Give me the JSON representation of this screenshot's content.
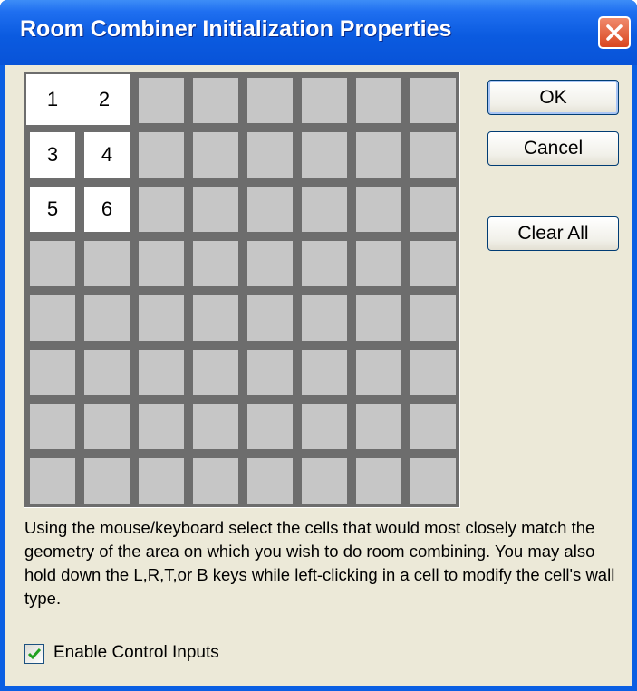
{
  "window": {
    "title": "Room Combiner Initialization Properties",
    "close_icon": "close-icon",
    "colors": {
      "titlebar": "#0a5fe3",
      "client": "#ece9d8",
      "close": "#d9461f"
    }
  },
  "grid": {
    "rows": 8,
    "columns": 8,
    "selected_cells": [
      {
        "row": 0,
        "col": 0,
        "label": "1"
      },
      {
        "row": 0,
        "col": 1,
        "label": "2"
      },
      {
        "row": 1,
        "col": 0,
        "label": "3"
      },
      {
        "row": 1,
        "col": 1,
        "label": "4"
      },
      {
        "row": 2,
        "col": 0,
        "label": "5"
      },
      {
        "row": 2,
        "col": 1,
        "label": "6"
      }
    ],
    "colors": {
      "wall": "#6d6d6d",
      "unselected": "#c6c6c6",
      "selected": "#ffffff"
    }
  },
  "buttons": {
    "ok": "OK",
    "cancel": "Cancel",
    "clear_all": "Clear All"
  },
  "instructions": "Using the mouse/keyboard select the cells that would most closely match the geometry of the area on which you wish to do room combining.  You may also hold down the L,R,T,or B keys while left-clicking in a cell to modify the cell's wall type.",
  "enable_control_inputs": {
    "label": "Enable Control Inputs",
    "checked": true,
    "icon": "checkmark-icon"
  }
}
